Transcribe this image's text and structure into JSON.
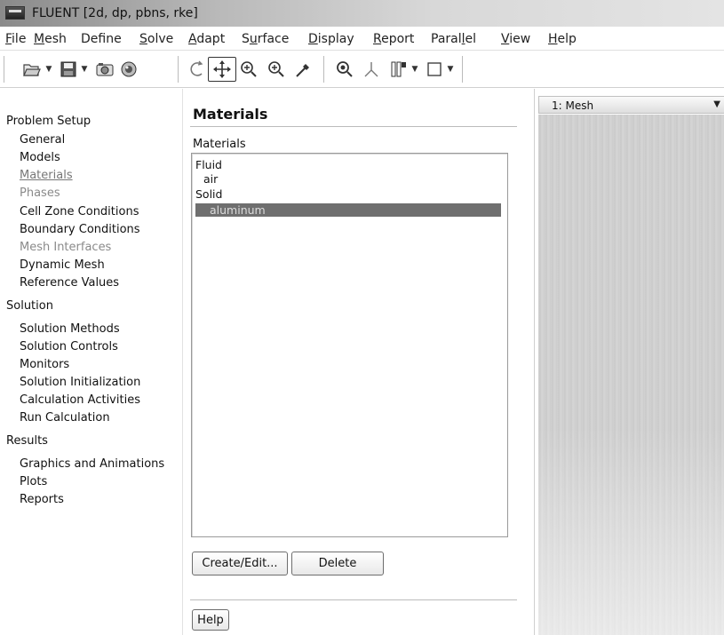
{
  "window": {
    "title": "FLUENT  [2d, dp, pbns, rke]"
  },
  "menu": [
    {
      "label": "File",
      "underline": "F",
      "rest": "ile"
    },
    {
      "label": "Mesh",
      "underline": "M",
      "rest": "esh"
    },
    {
      "label": "Define",
      "underline": "D",
      "rest": "efine",
      "prefix": ""
    },
    {
      "label": "Solve",
      "underline": "S",
      "rest": "olve"
    },
    {
      "label": "Adapt",
      "underline": "A",
      "rest": "dapt"
    },
    {
      "label": "Surface",
      "underline": "u",
      "rest": "rface",
      "prefix": "S"
    },
    {
      "label": "Display",
      "underline": "D",
      "rest": "isplay"
    },
    {
      "label": "Report",
      "underline": "R",
      "rest": "eport"
    },
    {
      "label": "Parallel",
      "underline": "l",
      "rest": "el",
      "prefix": "Paral"
    },
    {
      "label": "View",
      "underline": "V",
      "rest": "iew"
    },
    {
      "label": "Help",
      "underline": "H",
      "rest": "elp"
    }
  ],
  "toolbar": {
    "icons": [
      "open-icon",
      "save-icon",
      "camera-icon",
      "render-icon",
      "rotate-icon",
      "translate-icon",
      "zoom-in-icon",
      "zoom-box-icon",
      "probe-icon",
      "zoom-fit-icon",
      "axes-icon",
      "layout-icon",
      "window-icon"
    ]
  },
  "nav": {
    "sections": [
      {
        "label": "Problem Setup",
        "items": [
          {
            "label": "General",
            "state": "normal"
          },
          {
            "label": "Models",
            "state": "normal"
          },
          {
            "label": "Materials",
            "state": "selected"
          },
          {
            "label": "Phases",
            "state": "disabled"
          },
          {
            "label": "Cell Zone Conditions",
            "state": "normal"
          },
          {
            "label": "Boundary Conditions",
            "state": "normal"
          },
          {
            "label": "Mesh Interfaces",
            "state": "disabled"
          },
          {
            "label": "Dynamic Mesh",
            "state": "normal"
          },
          {
            "label": "Reference Values",
            "state": "normal"
          }
        ]
      },
      {
        "label": "Solution",
        "items": [
          {
            "label": "Solution Methods",
            "state": "normal"
          },
          {
            "label": "Solution Controls",
            "state": "normal"
          },
          {
            "label": "Monitors",
            "state": "normal"
          },
          {
            "label": "Solution Initialization",
            "state": "normal"
          },
          {
            "label": "Calculation Activities",
            "state": "normal"
          },
          {
            "label": "Run Calculation",
            "state": "normal"
          }
        ]
      },
      {
        "label": "Results",
        "items": [
          {
            "label": "Graphics and Animations",
            "state": "normal"
          },
          {
            "label": "Plots",
            "state": "normal"
          },
          {
            "label": "Reports",
            "state": "normal"
          }
        ]
      }
    ]
  },
  "panel": {
    "title": "Materials",
    "list_label": "Materials",
    "list": [
      {
        "label": "Fluid",
        "indent": 0,
        "selected": false
      },
      {
        "label": "air",
        "indent": 1,
        "selected": false
      },
      {
        "label": "Solid",
        "indent": 0,
        "selected": false
      },
      {
        "label": "aluminum",
        "indent": 1,
        "selected": true
      }
    ],
    "create_edit_label": "Create/Edit...",
    "delete_label": "Delete",
    "help_label": "Help"
  },
  "graphics": {
    "tab_label": "1: Mesh"
  }
}
